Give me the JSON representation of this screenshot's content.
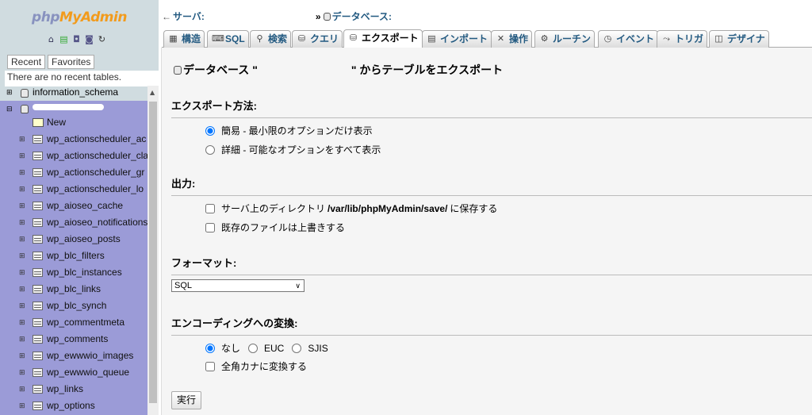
{
  "nav": {
    "logo": {
      "php": "php",
      "my": "My",
      "admin": "Admin"
    },
    "tabs": [
      "Recent",
      "Favorites"
    ],
    "recent_text": "There are no recent tables.",
    "top_db": "information_schema",
    "new_label": "New",
    "tables": [
      "wp_actionscheduler_ac",
      "wp_actionscheduler_cla",
      "wp_actionscheduler_gr",
      "wp_actionscheduler_lo",
      "wp_aioseo_cache",
      "wp_aioseo_notifications",
      "wp_aioseo_posts",
      "wp_blc_filters",
      "wp_blc_instances",
      "wp_blc_links",
      "wp_blc_synch",
      "wp_commentmeta",
      "wp_comments",
      "wp_ewwwio_images",
      "wp_ewwwio_queue",
      "wp_links",
      "wp_options"
    ],
    "bg_color": "#9b9bd7"
  },
  "breadcrumb": {
    "server_label": "サーバ:",
    "database_label": "データベース:"
  },
  "tabs": [
    {
      "label": "構造",
      "icon": "structure-icon",
      "glyph": "▦"
    },
    {
      "label": "SQL",
      "icon": "sql-icon",
      "glyph": "⌨"
    },
    {
      "label": "検索",
      "icon": "search-icon",
      "glyph": "⚲"
    },
    {
      "label": "クエリ",
      "icon": "query-icon",
      "glyph": "⛁"
    },
    {
      "label": "エクスポート",
      "icon": "export-icon",
      "glyph": "⛁",
      "active": true
    },
    {
      "label": "インポート",
      "icon": "import-icon",
      "glyph": "▤"
    },
    {
      "label": "操作",
      "icon": "operations-icon",
      "glyph": "✕"
    },
    {
      "label": "ルーチン",
      "icon": "routines-icon",
      "glyph": "⚙"
    },
    {
      "label": "イベント",
      "icon": "events-icon",
      "glyph": "◷"
    },
    {
      "label": "トリガ",
      "icon": "triggers-icon",
      "glyph": "⤳"
    },
    {
      "label": "デザイナ",
      "icon": "designer-icon",
      "glyph": "◫"
    }
  ],
  "page": {
    "title_prefix": "データベース \"",
    "title_suffix": "\" からテーブルをエクスポート",
    "export_method": {
      "heading": "エクスポート方法:",
      "options": [
        {
          "label": "簡易 - 最小限のオプションだけ表示",
          "checked": true
        },
        {
          "label": "詳細 - 可能なオプションをすべて表示",
          "checked": false
        }
      ]
    },
    "output": {
      "heading": "出力:",
      "save_dir_prefix": "サーバ上のディレクトリ",
      "save_dir_path": "/var/lib/phpMyAdmin/save/",
      "save_dir_suffix": "に保存する",
      "overwrite": "既存のファイルは上書きする"
    },
    "format": {
      "heading": "フォーマット:",
      "selected": "SQL"
    },
    "encoding": {
      "heading": "エンコーディングへの変換:",
      "options": [
        {
          "label": "なし",
          "checked": true
        },
        {
          "label": "EUC",
          "checked": false
        },
        {
          "label": "SJIS",
          "checked": false
        }
      ],
      "kana": "全角カナに変換する"
    },
    "go_button": "実行"
  }
}
